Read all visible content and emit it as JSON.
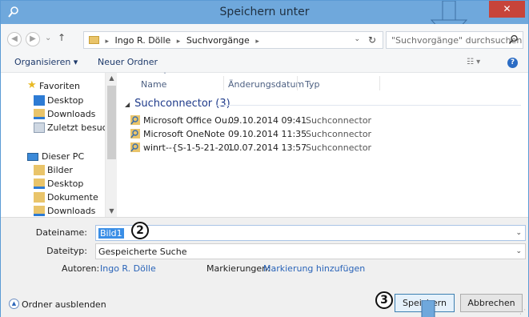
{
  "window": {
    "title": "Speichern unter",
    "close": "✕"
  },
  "address": {
    "crumbs": [
      "Ingo R. Dölle",
      "Suchvorgänge"
    ],
    "search_placeholder": "\"Suchvorgänge\" durchsuchen"
  },
  "toolbar": {
    "organize": "Organisieren ▾",
    "new_folder": "Neuer Ordner"
  },
  "nav": {
    "favorites": "Favoriten",
    "fav_items": [
      "Desktop",
      "Downloads",
      "Zuletzt besucht"
    ],
    "this_pc": "Dieser PC",
    "pc_items": [
      "Bilder",
      "Desktop",
      "Dokumente",
      "Downloads"
    ]
  },
  "columns": {
    "name": "Name",
    "date": "Änderungsdatum",
    "type": "Typ"
  },
  "group": {
    "label": "Suchconnector (3)"
  },
  "files": [
    {
      "name": "Microsoft Office Ou...",
      "date": "09.10.2014 09:41",
      "type": "Suchconnector"
    },
    {
      "name": "Microsoft OneNote",
      "date": "09.10.2014 11:35",
      "type": "Suchconnector"
    },
    {
      "name": "winrt--{S-1-5-21-20...",
      "date": "10.07.2014 13:57",
      "type": "Suchconnector"
    }
  ],
  "form": {
    "filename_label": "Dateiname:",
    "filename_value": "Bild1",
    "filetype_label": "Dateityp:",
    "filetype_value": "Gespeicherte Suche",
    "authors_label": "Autoren:",
    "authors_value": "Ingo R. Dölle",
    "tags_label": "Markierungen:",
    "tags_value": "Markierung hinzufügen"
  },
  "footer": {
    "hide_folders": "Ordner ausblenden",
    "save": "Speichern",
    "cancel": "Abbrechen"
  },
  "badges": {
    "step2": "2",
    "step3": "3"
  },
  "colors": {
    "titlebar": "#6fa8dc",
    "accent": "#3a8ee6",
    "close": "#c7443a",
    "callout_arrow": "#6fa8dc"
  }
}
